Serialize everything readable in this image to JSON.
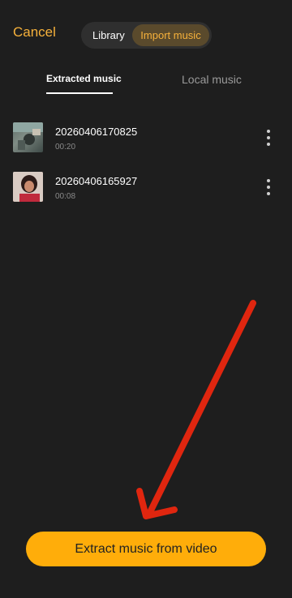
{
  "header": {
    "cancel_label": "Cancel",
    "segmented": {
      "library_label": "Library",
      "import_label": "Import music",
      "selected": "Import music"
    }
  },
  "tabs": {
    "extracted_label": "Extracted music",
    "local_label": "Local music",
    "active": "Extracted music"
  },
  "items": [
    {
      "title": "20260406170825",
      "duration": "00:20",
      "icon": "more-vertical-icon"
    },
    {
      "title": "20260406165927",
      "duration": "00:08",
      "icon": "more-vertical-icon"
    }
  ],
  "footer": {
    "extract_label": "Extract music from video"
  },
  "colors": {
    "background": "#1e1e1e",
    "accent": "#f6b13b",
    "button": "#ffad0a",
    "annotation_arrow": "#e0260f"
  }
}
